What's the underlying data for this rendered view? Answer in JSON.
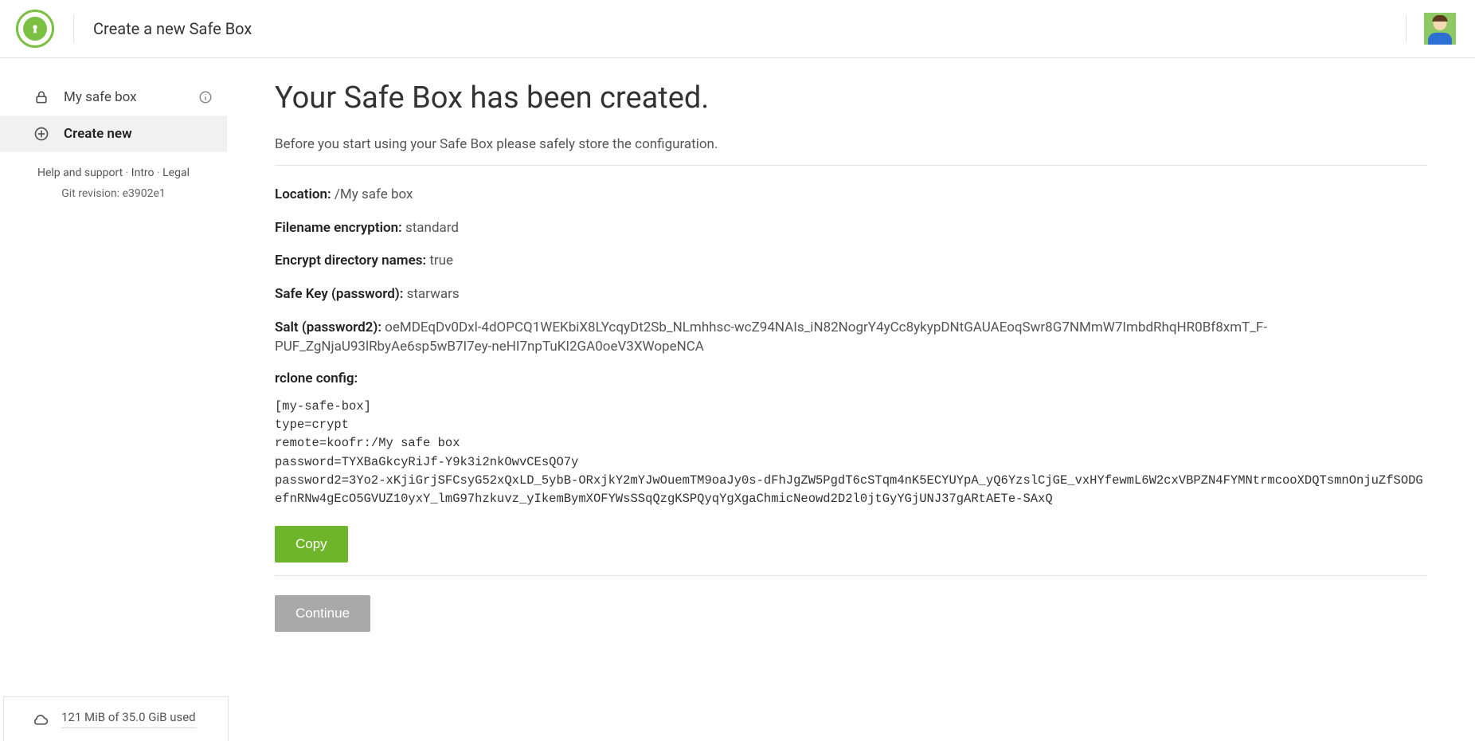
{
  "header": {
    "title": "Create a new Safe Box"
  },
  "sidebar": {
    "items": [
      {
        "label": "My safe box",
        "icon": "lock-icon",
        "active": false,
        "has_info": true
      },
      {
        "label": "Create new",
        "icon": "plus-circle-icon",
        "active": true,
        "has_info": false
      }
    ],
    "footer_links": [
      "Help and support",
      "Intro",
      "Legal"
    ],
    "revision_label": "Git revision:",
    "revision_value": "e3902e1"
  },
  "main": {
    "title": "Your Safe Box has been created.",
    "subtitle": "Before you start using your Safe Box please safely store the configuration.",
    "kv": {
      "location_label": "Location:",
      "location_value": "/My safe box",
      "filename_enc_label": "Filename encryption:",
      "filename_enc_value": "standard",
      "encrypt_dir_label": "Encrypt directory names:",
      "encrypt_dir_value": "true",
      "safekey_label": "Safe Key (password):",
      "safekey_value": "starwars",
      "salt_label": "Salt (password2):",
      "salt_value": "oeMDEqDv0Dxl-4dOPCQ1WEKbiX8LYcqyDt2Sb_NLmhhsc-wcZ94NAIs_iN82NogrY4yCc8ykypDNtGAUAEoqSwr8G7NMmW7ImbdRhqHR0Bf8xmT_F-PUF_ZgNjaU93lRbyAe6sp5wB7I7ey-neHI7npTuKI2GA0oeV3XWopeNCA"
    },
    "rclone_label": "rclone config:",
    "rclone_config": "[my-safe-box]\ntype=crypt\nremote=koofr:/My safe box\npassword=TYXBaGkcyRiJf-Y9k3i2nkOwvCEsQO7y\npassword2=3Yo2-xKjiGrjSFCsyG52xQxLD_5ybB-ORxjkY2mYJwOuemTM9oaJy0s-dFhJgZW5PgdT6cSTqm4nK5ECYUYpA_yQ6YzslCjGE_vxHYfewmL6W2cxVBPZN4FYMNtrmcooXDQTsmnOnjuZfSODGefnRNw4gEcO5GVUZ10yxY_lmG97hzkuvz_yIkemBymXOFYWsSSqQzgKSPQyqYgXgaChmicNeowd2D2l0jtGyYGjUNJ37gARtAETe-SAxQ",
    "copy_label": "Copy",
    "continue_label": "Continue"
  },
  "storage": {
    "text": "121 MiB of 35.0 GiB used"
  }
}
